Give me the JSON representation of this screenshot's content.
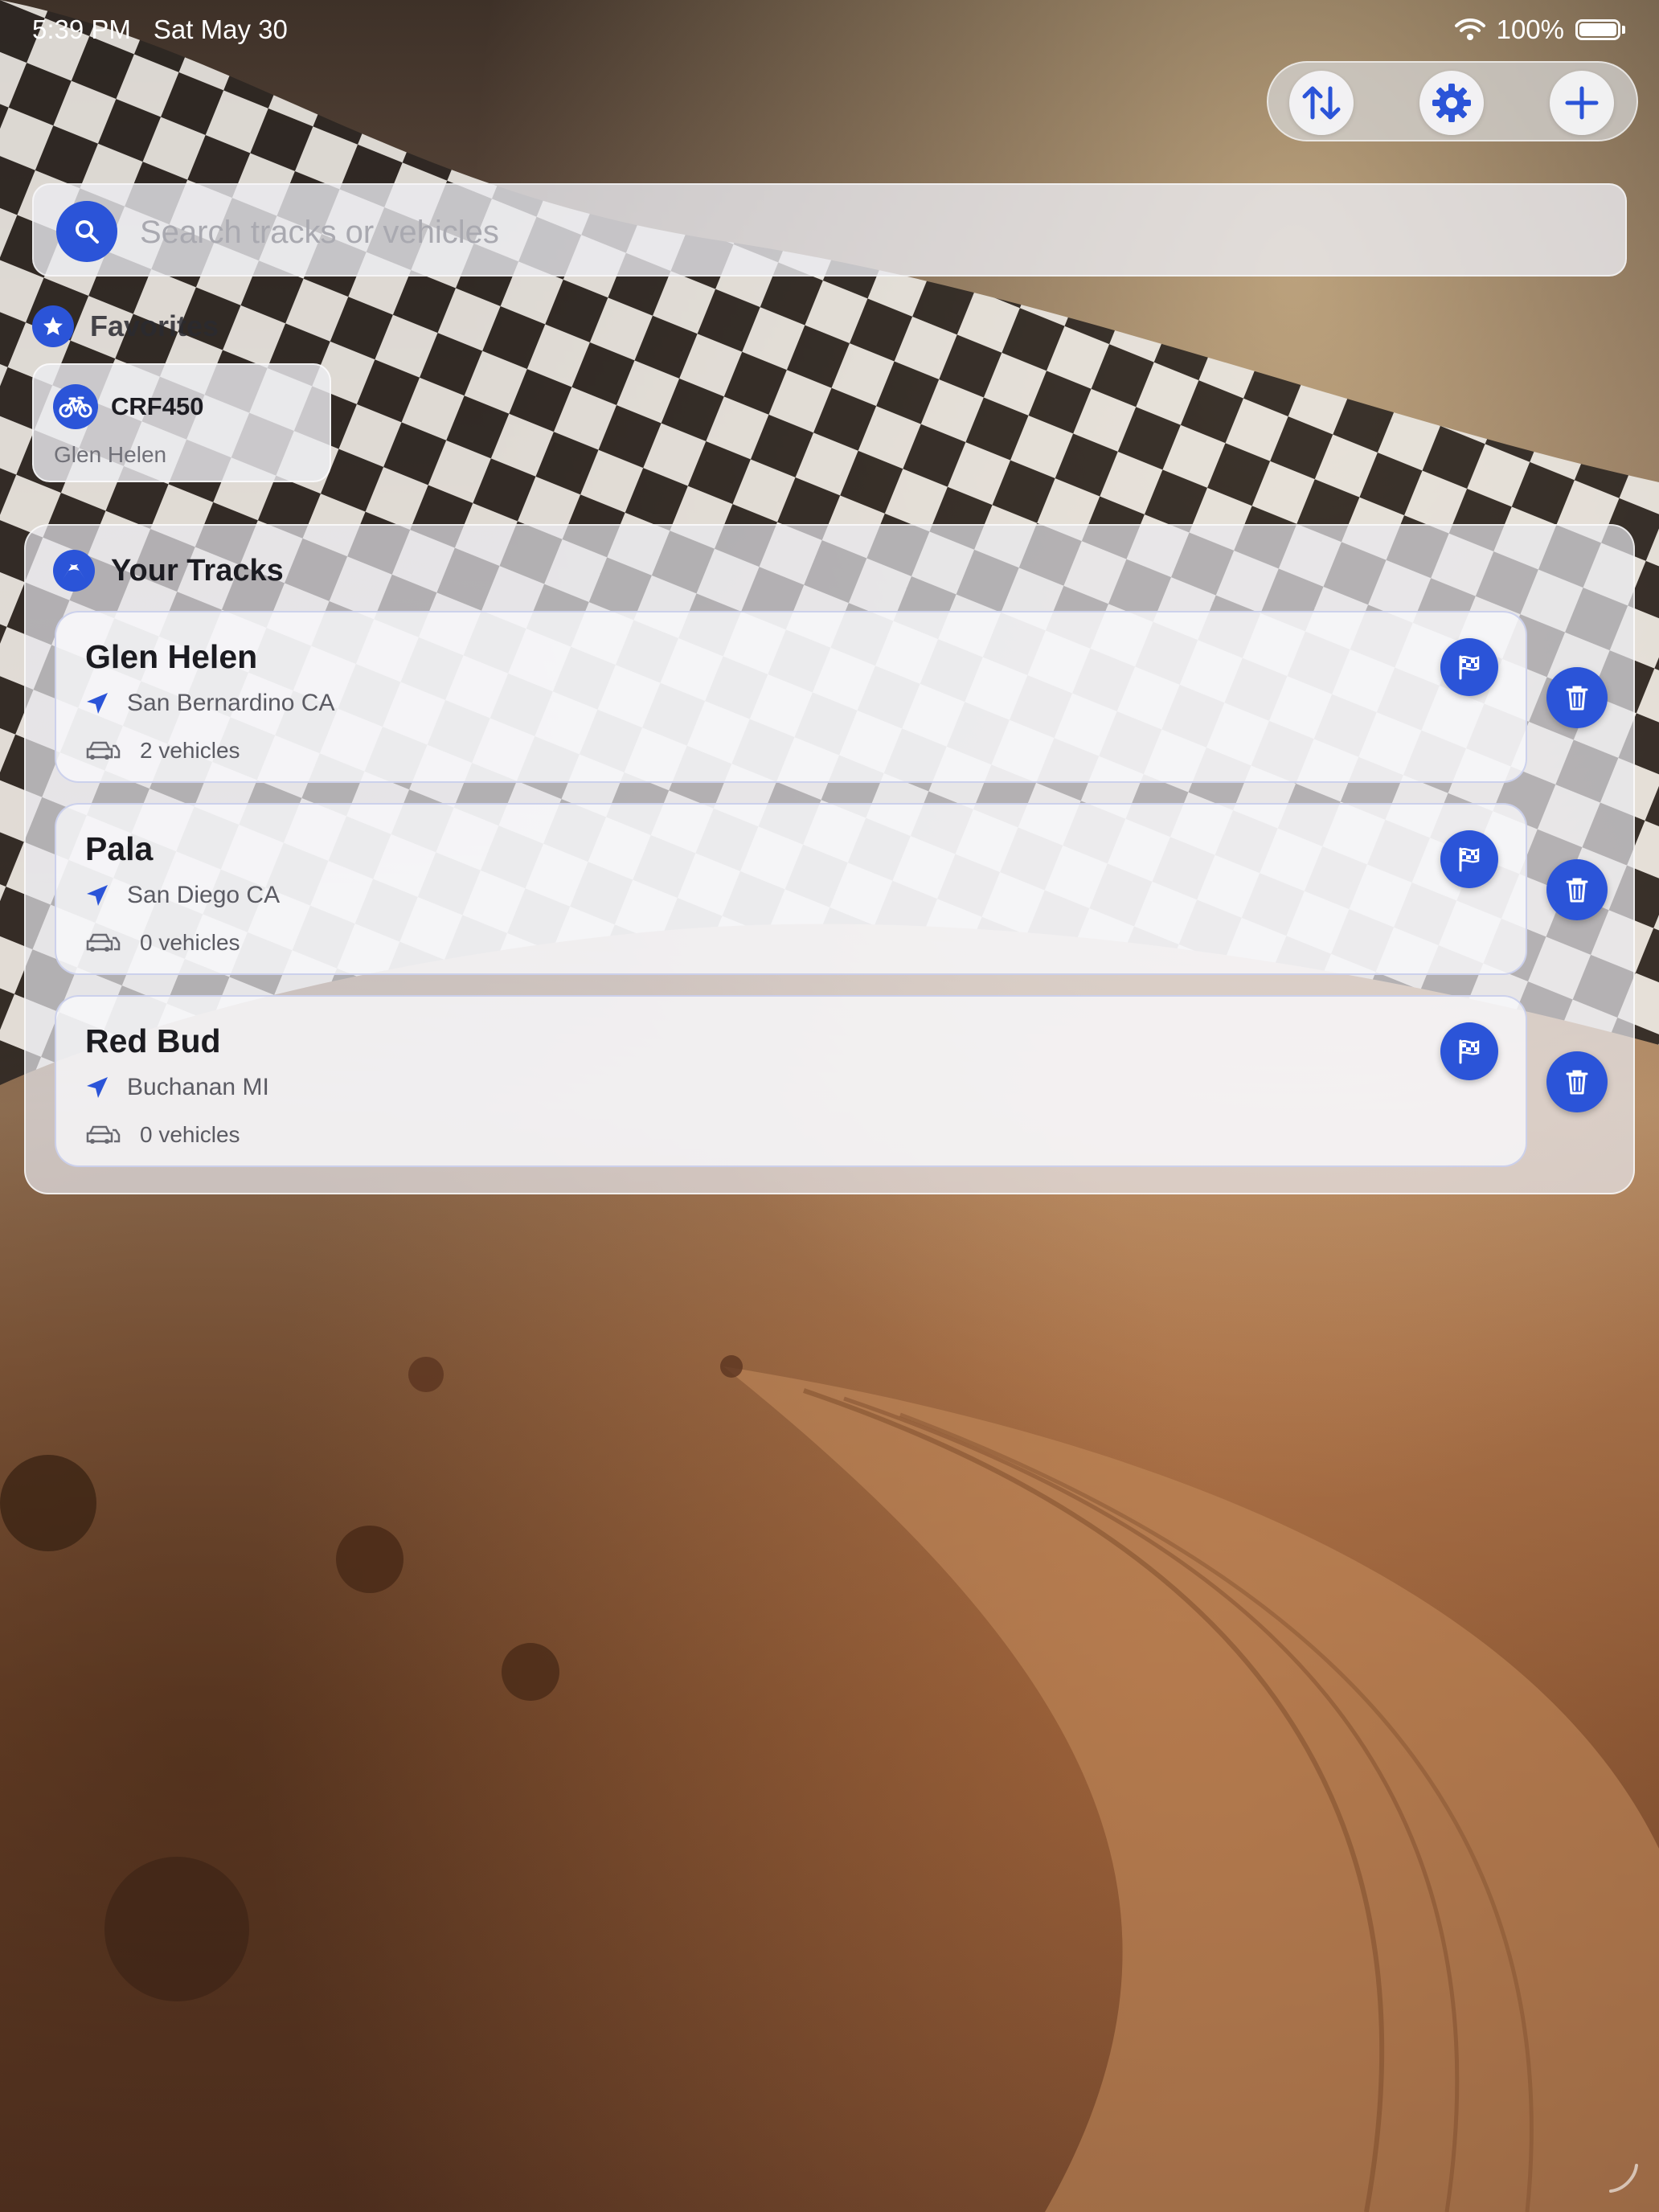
{
  "status_bar": {
    "time": "5:39 PM",
    "date": "Sat May 30",
    "battery": "100%",
    "battery_level": 1.0,
    "icons": [
      "wifi-icon",
      "battery-icon"
    ]
  },
  "toolbar": {
    "buttons": [
      {
        "name": "sort-button",
        "icon": "arrow-up-down-icon"
      },
      {
        "name": "settings-button",
        "icon": "gear-icon"
      },
      {
        "name": "add-button",
        "icon": "plus-icon"
      }
    ]
  },
  "search": {
    "placeholder": "Search tracks or vehicles",
    "value": ""
  },
  "favorites": {
    "title": "Favorites",
    "items": [
      {
        "vehicle": "CRF450",
        "track": "Glen Helen",
        "icon": "bicycle-icon"
      }
    ]
  },
  "tracks": {
    "title": "Your Tracks",
    "items": [
      {
        "name": "Glen Helen",
        "location": "San Bernardino CA",
        "vehicles": "2 vehicles"
      },
      {
        "name": "Pala",
        "location": "San Diego CA",
        "vehicles": "0 vehicles"
      },
      {
        "name": "Red Bud",
        "location": "Buchanan MI",
        "vehicles": "0 vehicles"
      }
    ]
  },
  "colors": {
    "accent": "#2b54d8",
    "panel": "#e8e8ee",
    "text_primary": "#1b1b20",
    "text_secondary": "#5b5b63"
  }
}
